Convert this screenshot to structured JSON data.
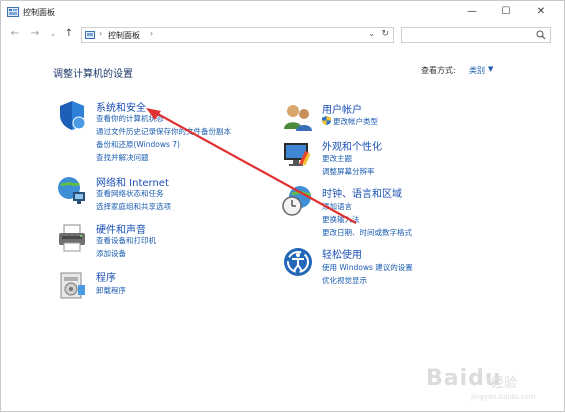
{
  "window": {
    "title": "控制面板",
    "minimize": "—",
    "maximize": "☐",
    "close": "✕"
  },
  "nav": {
    "back": "←",
    "forward": "→",
    "recent": "⌄",
    "up": "↑",
    "breadcrumb": "控制面板",
    "sep": "›",
    "sep2": "›",
    "dropdown": "⌄",
    "refresh": "↻"
  },
  "header": {
    "page_title": "调整计算机的设置",
    "viewby_label": "查看方式:",
    "viewby_value": "类别",
    "viewby_caret": "▼"
  },
  "categories": [
    {
      "title": "系统和安全",
      "icon": "shield-icon",
      "links": [
        "查看你的计算机状态",
        "通过文件历史记录保存你的文件备份副本",
        "备份和还原(Windows 7)",
        "查找并解决问题"
      ]
    },
    {
      "title": "网络和 Internet",
      "icon": "network-globe-icon",
      "links": [
        "查看网络状态和任务",
        "选择家庭组和共享选项"
      ]
    },
    {
      "title": "硬件和声音",
      "icon": "printer-icon",
      "links": [
        "查看设备和打印机",
        "添加设备"
      ]
    },
    {
      "title": "程序",
      "icon": "programs-icon",
      "links": [
        "卸载程序"
      ]
    },
    {
      "title": "用户帐户",
      "icon": "users-icon",
      "links": [
        "更改帐户类型"
      ]
    },
    {
      "title": "外观和个性化",
      "icon": "monitor-paint-icon",
      "links": [
        "更改主题",
        "调整屏幕分辨率"
      ]
    },
    {
      "title": "时钟、语言和区域",
      "icon": "clock-globe-icon",
      "links": [
        "添加语言",
        "更换输入法",
        "更改日期、时间或数字格式"
      ]
    },
    {
      "title": "轻松使用",
      "icon": "ease-of-access-icon",
      "links": [
        "使用 Windows 建议的设置",
        "优化视觉显示"
      ]
    }
  ],
  "watermark": {
    "brand": "Baidu",
    "sub": "经验",
    "url": "jingyan.baidu.com"
  },
  "colors": {
    "accent_link": "#1a5cb0",
    "annotation_arrow": "#e03030"
  }
}
